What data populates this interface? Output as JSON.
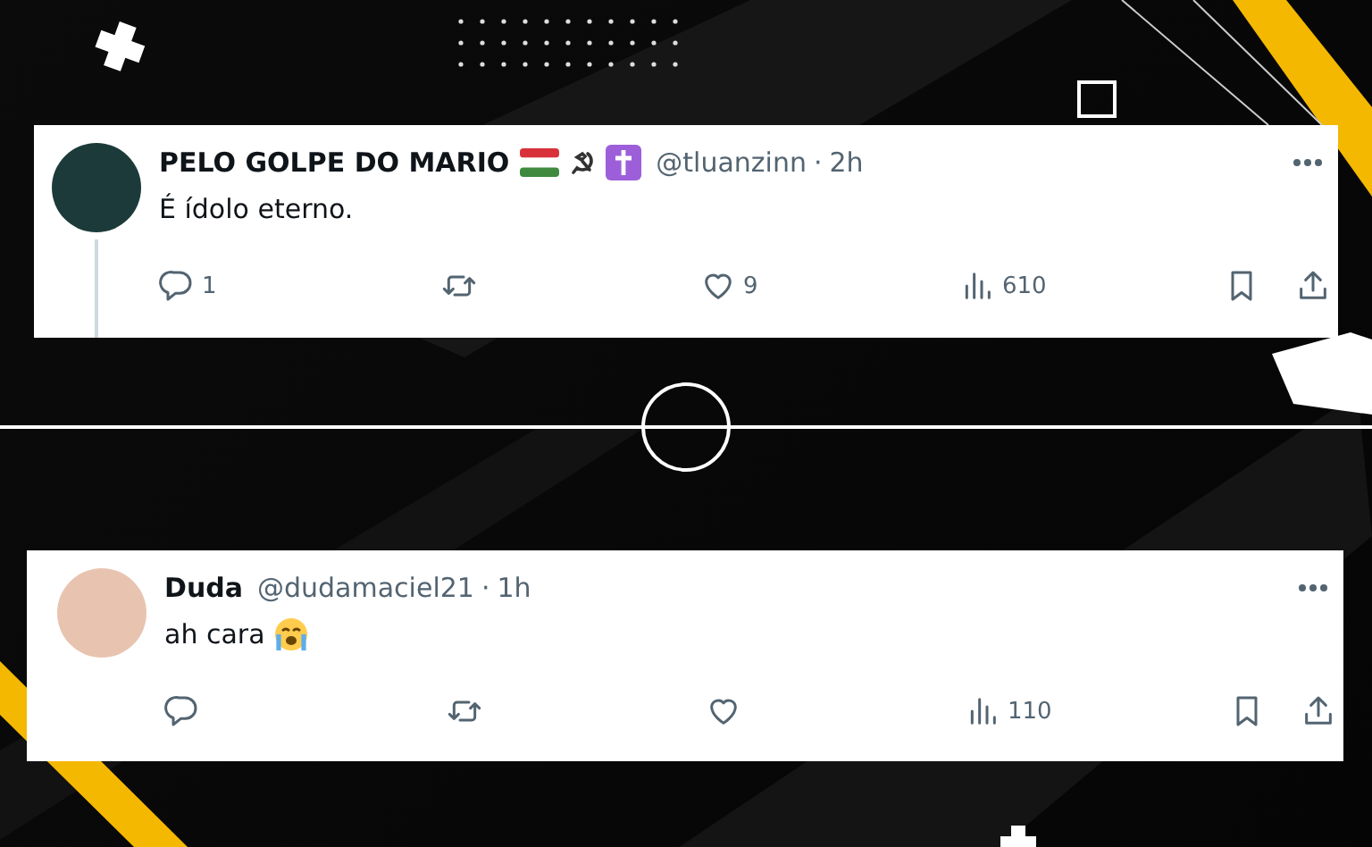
{
  "tweets": [
    {
      "author": "PELO GOLPE DO MARIO",
      "badges": [
        {
          "kind": "flag-hungary"
        },
        {
          "kind": "hammer-sickle"
        },
        {
          "kind": "cross"
        }
      ],
      "handle": "@tluanzinn",
      "separator": "·",
      "time": "2h",
      "text": "É ídolo eterno.",
      "thread": true,
      "replies": "1",
      "likes": "9",
      "views": "610"
    },
    {
      "author": "Duda",
      "handle": "@dudamaciel21",
      "separator": "·",
      "time": "1h",
      "text": "ah cara",
      "emojis": [
        {
          "kind": "sob"
        }
      ],
      "thread": false,
      "views": "110"
    }
  ]
}
